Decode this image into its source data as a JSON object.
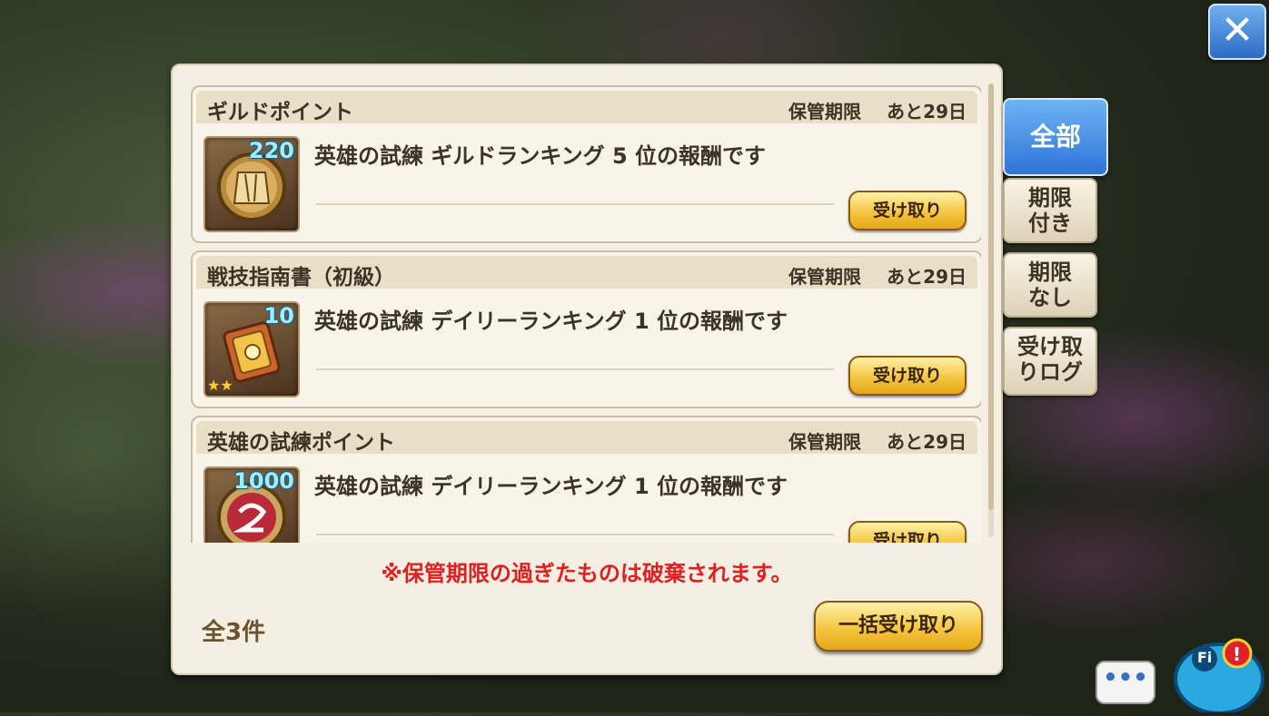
{
  "header": {
    "close_icon": "close-icon"
  },
  "items": [
    {
      "name": "ギルドポイント",
      "expiry_label": "保管期限",
      "expiry_value": "あと29日",
      "qty": "220",
      "icon": "guild-point-icon",
      "description": "英雄の試練 ギルドランキング 5 位の報酬です",
      "button": "受け取り"
    },
    {
      "name": "戦技指南書（初級）",
      "expiry_label": "保管期限",
      "expiry_value": "あと29日",
      "qty": "10",
      "icon": "book-icon",
      "stars": "★★",
      "description": "英雄の試練 デイリーランキング 1 位の報酬です",
      "button": "受け取り"
    },
    {
      "name": "英雄の試練ポイント",
      "expiry_label": "保管期限",
      "expiry_value": "あと29日",
      "qty": "1000",
      "icon": "hero-trial-point-icon",
      "description": "英雄の試練 デイリーランキング 1 位の報酬です",
      "button": "受け取り"
    }
  ],
  "notice": "※保管期限の過ぎたものは破棄されます。",
  "total": "全3件",
  "bulk_button": "一括受け取り",
  "tabs": [
    {
      "label": "全部",
      "active": true
    },
    {
      "label": "期限付き"
    },
    {
      "label": "期限なし"
    },
    {
      "label": "受け取りログ"
    }
  ],
  "chat_button": "•••",
  "colors": {
    "accent": "#2f74d8",
    "warning": "#e02020",
    "button_gold": "#f3c23a"
  }
}
